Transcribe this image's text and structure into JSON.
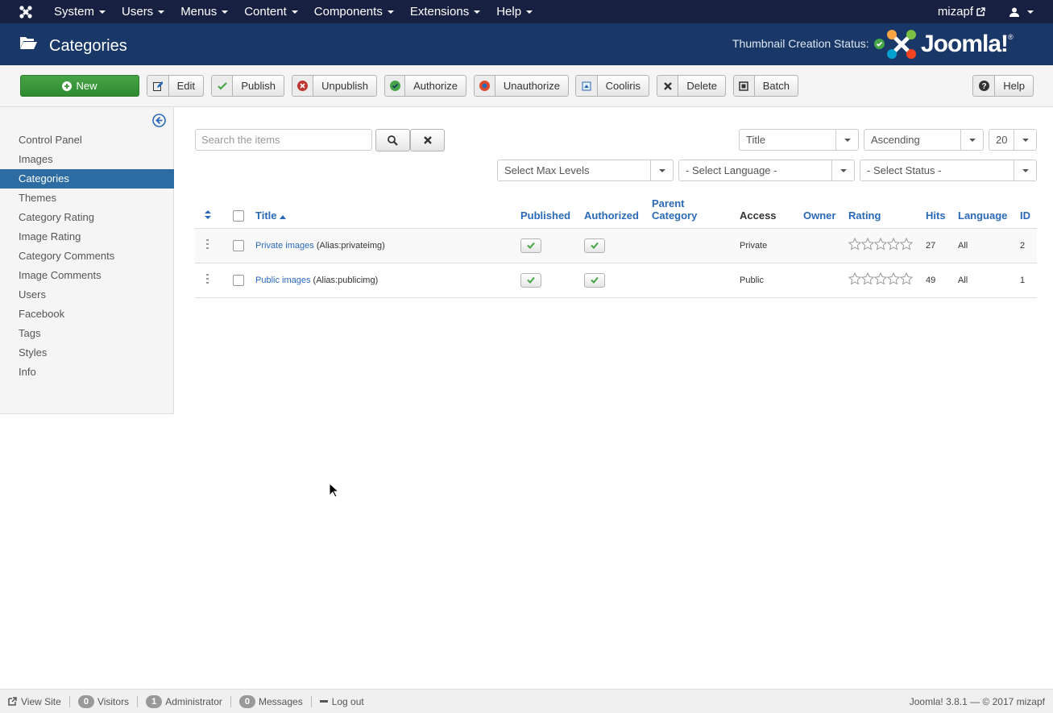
{
  "navbar": {
    "menu": [
      "System",
      "Users",
      "Menus",
      "Content",
      "Components",
      "Extensions",
      "Help"
    ],
    "user": "mizapf"
  },
  "header": {
    "title": "Categories",
    "thumbnail_status": "Thumbnail Creation Status:"
  },
  "toolbar": {
    "new": "New",
    "edit": "Edit",
    "publish": "Publish",
    "unpublish": "Unpublish",
    "authorize": "Authorize",
    "unauthorize": "Unauthorize",
    "cooliris": "Cooliris",
    "delete": "Delete",
    "batch": "Batch",
    "help": "Help"
  },
  "sidebar": {
    "items": [
      "Control Panel",
      "Images",
      "Categories",
      "Themes",
      "Category Rating",
      "Image Rating",
      "Category Comments",
      "Image Comments",
      "Users",
      "Facebook",
      "Tags",
      "Styles",
      "Info"
    ],
    "active": "Categories"
  },
  "filters": {
    "search_placeholder": "Search the items",
    "order_by": "Title",
    "direction": "Ascending",
    "limit": "20",
    "max_levels": "Select Max Levels",
    "language": "- Select Language -",
    "status": "- Select Status -"
  },
  "table": {
    "headers": {
      "title": "Title",
      "published": "Published",
      "authorized": "Authorized",
      "parent_line1": "Parent",
      "parent_line2": "Category",
      "access": "Access",
      "owner": "Owner",
      "rating": "Rating",
      "hits": "Hits",
      "language": "Language",
      "id": "ID"
    },
    "rows": [
      {
        "title": "Private images",
        "alias": "(Alias:privateimg)",
        "access": "Private",
        "hits": "27",
        "language": "All",
        "id": "2",
        "published": true,
        "authorized": true,
        "rating": 0
      },
      {
        "title": "Public images",
        "alias": "(Alias:publicimg)",
        "access": "Public",
        "hits": "49",
        "language": "All",
        "id": "1",
        "published": true,
        "authorized": true,
        "rating": 0
      }
    ]
  },
  "footer": {
    "view_site": "View Site",
    "visitors_count": "0",
    "visitors": "Visitors",
    "admin_count": "1",
    "admin": "Administrator",
    "messages_count": "0",
    "messages": "Messages",
    "logout": "Log out",
    "version": "Joomla! 3.8.1 — © 2017 mizapf"
  },
  "colors": {
    "navbar": "#172040",
    "header": "#1a3867",
    "accent": "#2a69b8",
    "active_sidebar": "#2d6ca2",
    "new_button": "#46a546"
  }
}
